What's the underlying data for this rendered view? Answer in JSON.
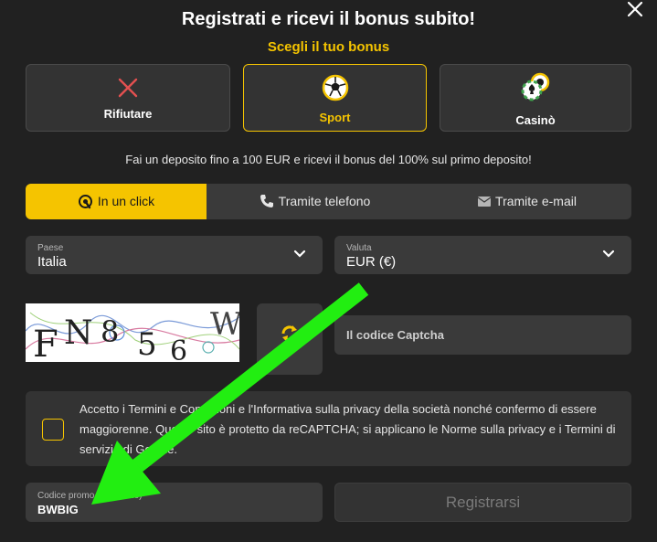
{
  "modal": {
    "title": "Registrati e ricevi il bonus subito!",
    "subtitle": "Scegli il tuo bonus",
    "accent_color": "#f5c400"
  },
  "bonus_options": [
    {
      "label": "Rifiutare",
      "icon": "x-icon",
      "selected": false
    },
    {
      "label": "Sport",
      "icon": "soccer-ball-icon",
      "selected": true
    },
    {
      "label": "Casinò",
      "icon": "casino-chips-icon",
      "selected": false
    }
  ],
  "info_text": "Fai un deposito fino a 100 EUR e ricevi il bonus del 100% sul primo deposito!",
  "tabs": [
    {
      "label": "In un click",
      "icon": "one-click-icon",
      "active": true
    },
    {
      "label": "Tramite telefono",
      "icon": "phone-icon",
      "active": false
    },
    {
      "label": "Tramite e-mail",
      "icon": "envelope-icon",
      "active": false
    }
  ],
  "country": {
    "label": "Paese",
    "value": "Italia"
  },
  "currency": {
    "label": "Valuta",
    "value": "EUR (€)"
  },
  "captcha": {
    "image_text": "FN856W",
    "placeholder": "Il codice Captcha"
  },
  "terms_text": "Accetto i Termini e Condizioni e l'Informativa sulla privacy della società nonché confermo di essere maggiorenne. Questo sito è protetto da reCAPTCHA; si applicano le Norme sulla privacy e i Termini di servizio di Google.",
  "promo": {
    "label": "Codice promo (opzionale)",
    "value": "BWBIG"
  },
  "register_label": "Registrarsi",
  "annotation": {
    "color": "#22ee11"
  }
}
